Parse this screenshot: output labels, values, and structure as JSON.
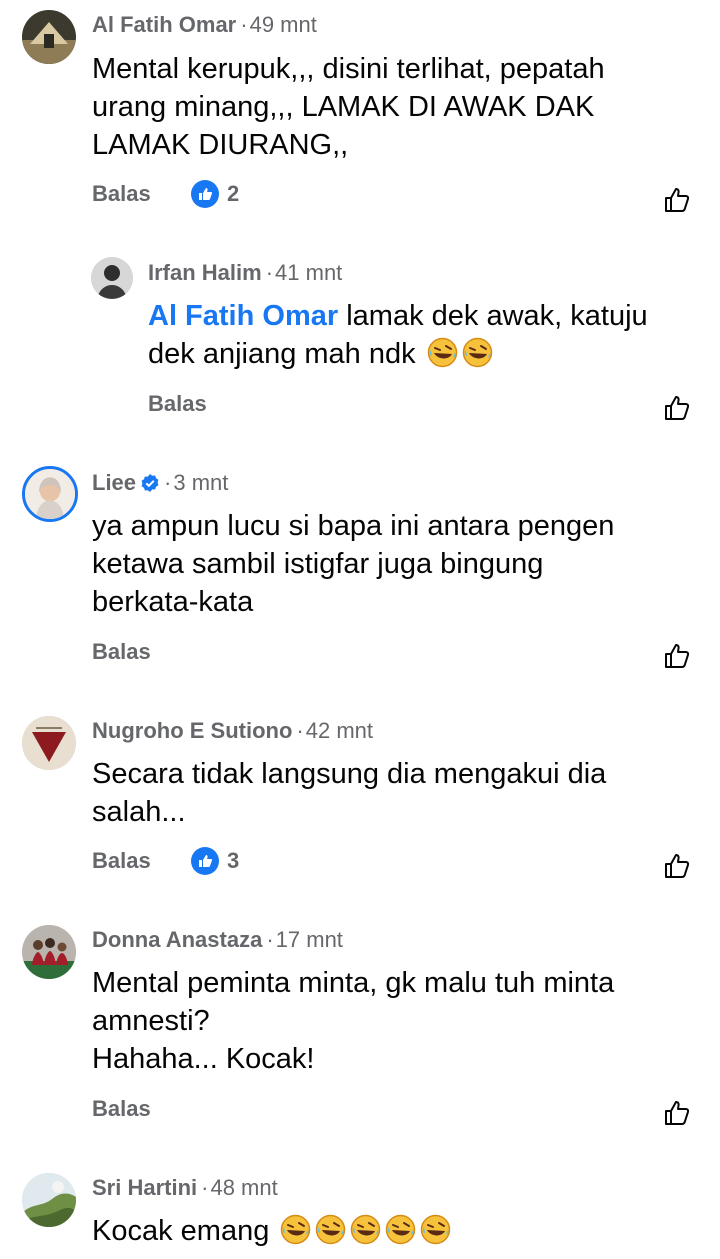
{
  "comments": [
    {
      "author": "Al Fatih Omar",
      "time": "49 mnt",
      "text": "Mental kerupuk,,, disini terlihat, pepatah\nurang minang,,, LAMAK DI AWAK DAK\nLAMAK DIURANG,,",
      "reply_label": "Balas",
      "likes": "2",
      "avatar_icon": "avatar-al-fatih-omar"
    },
    {
      "author": "Irfan Halim",
      "time": "41 mnt",
      "mention": "Al Fatih Omar",
      "text": " lamak dek awak, katuju\ndek anjiang mah ndk ",
      "emoji": [
        "rolling-laughing-emoji",
        "rolling-laughing-emoji"
      ],
      "reply_label": "Balas",
      "avatar_icon": "avatar-irfan-halim"
    },
    {
      "author": "Liee",
      "verified_icon": "verified-badge-icon",
      "time": "3 mnt",
      "text": "ya ampun lucu si bapa ini antara pengen\nketawa sambil istigfar juga bingung\nberkata-kata",
      "reply_label": "Balas",
      "avatar_icon": "avatar-liee"
    },
    {
      "author": "Nugroho E Sutiono",
      "time": "42 mnt",
      "text": "Secara tidak langsung dia mengakui dia\nsalah...",
      "reply_label": "Balas",
      "likes": "3",
      "avatar_icon": "avatar-nugroho"
    },
    {
      "author": "Donna Anastaza",
      "time": "17 mnt",
      "text": "Mental peminta minta, gk malu tuh minta\namnesti?\nHahaha... Kocak!",
      "reply_label": "Balas",
      "avatar_icon": "avatar-donna"
    },
    {
      "author": "Sri Hartini",
      "time": "48 mnt",
      "text": "Kocak emang ",
      "emoji": [
        "rolling-laughing-emoji",
        "rolling-laughing-emoji",
        "rolling-laughing-emoji",
        "rolling-laughing-emoji",
        "rolling-laughing-emoji"
      ],
      "avatar_icon": "avatar-sri-hartini"
    }
  ],
  "colors": {
    "accent": "#1877f2",
    "meta": "#65676b",
    "text": "#050505"
  },
  "separator": "·"
}
